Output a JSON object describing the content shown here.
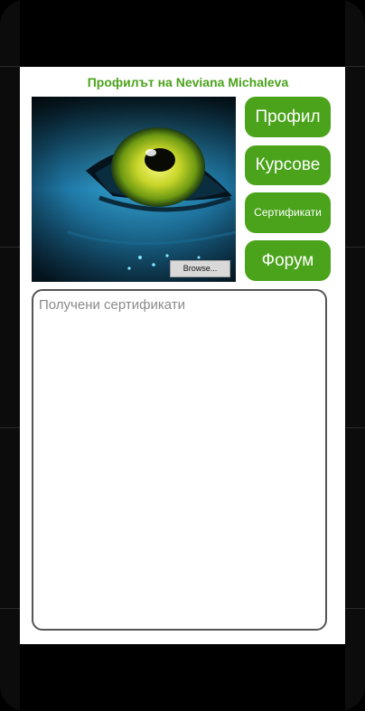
{
  "page": {
    "title": "Профилът на Neviana Michaleva"
  },
  "profile_photo": {
    "browse_label": "Browse..."
  },
  "nav": {
    "profile_label": "Профил",
    "courses_label": "Курсове",
    "certificates_label": "Сертификати",
    "forum_label": "Форум"
  },
  "certificates": {
    "placeholder": "Получени сертификати"
  },
  "colors": {
    "accent": "#4aa31a",
    "iris": "#c8d62a",
    "skin": "#2a8fc0"
  }
}
